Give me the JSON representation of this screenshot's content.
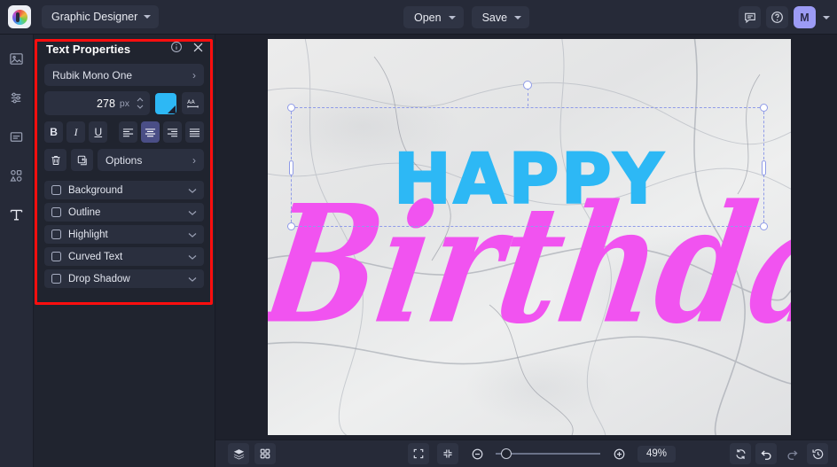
{
  "header": {
    "logo_icon": "bee-logo-icon",
    "app_switcher": {
      "label": "Graphic Designer",
      "chevron": "chevron-down-icon"
    },
    "open_button": "Open",
    "save_button": "Save",
    "comment_icon": "comment-icon",
    "help_icon": "help-circle-icon",
    "avatar_initial": "M"
  },
  "rail": {
    "items": [
      {
        "icon": "image-icon",
        "name": "sidebar-item-image"
      },
      {
        "icon": "adjust-sliders-icon",
        "name": "sidebar-item-adjust"
      },
      {
        "icon": "text-block-icon",
        "name": "sidebar-item-textblock"
      },
      {
        "icon": "shapes-icon",
        "name": "sidebar-item-shapes"
      },
      {
        "icon": "text-tool-icon",
        "name": "sidebar-item-text"
      }
    ]
  },
  "panel": {
    "title": "Text Properties",
    "info_icon": "info-circle-icon",
    "close_icon": "close-icon",
    "font_family": "Rubik Mono One",
    "font_size": "278",
    "font_size_unit": "px",
    "color_swatch": "#2DB8F5",
    "letter_spacing_icon": "letter-spacing-icon",
    "bold_label": "B",
    "italic_label": "I",
    "underline_label": "U",
    "align_icons": [
      "align-left-icon",
      "align-center-icon",
      "align-right-icon",
      "align-justify-icon"
    ],
    "align_selected": "align-center-icon",
    "delete_icon": "trash-icon",
    "duplicate_icon": "duplicate-icon",
    "options_label": "Options",
    "accordions": [
      {
        "label": "Background",
        "checked": false
      },
      {
        "label": "Outline",
        "checked": false
      },
      {
        "label": "Highlight",
        "checked": false
      },
      {
        "label": "Curved Text",
        "checked": false
      },
      {
        "label": "Drop Shadow",
        "checked": false
      }
    ],
    "highlight_border_color": "#FF0E0E"
  },
  "canvas": {
    "line1": "HAPPY",
    "line1_color": "#2DB8F5",
    "line2": "Birthday",
    "line2_color": "#F153F0"
  },
  "bottom": {
    "layers_icon": "layers-icon",
    "grid_icon": "grid-icon",
    "fit_icon": "fit-screen-icon",
    "shrink_icon": "shrink-icon",
    "zoom_out_icon": "zoom-out-icon",
    "zoom_in_icon": "zoom-in-icon",
    "zoom_level": "49%",
    "sync_icon": "sync-icon",
    "undo_icon": "undo-icon",
    "redo_icon": "redo-icon",
    "history_icon": "history-icon"
  }
}
